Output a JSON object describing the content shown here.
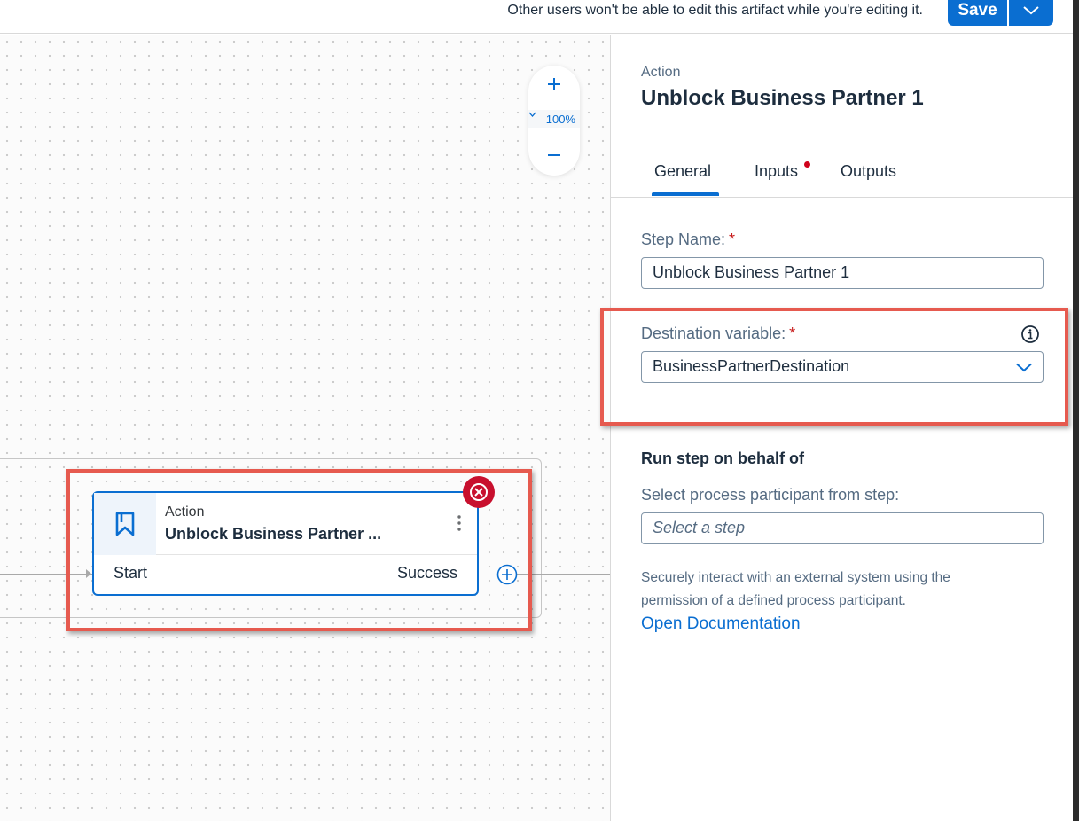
{
  "topbar": {
    "lock_message": "Other users won't be able to edit this artifact while you're editing it.",
    "save_label": "Save"
  },
  "canvas": {
    "zoom_level": "100%",
    "node": {
      "type": "Action",
      "title": "Unblock Business Partner ...",
      "start_label": "Start",
      "success_label": "Success",
      "icon": "bookmark-icon"
    }
  },
  "panel": {
    "type": "Action",
    "title": "Unblock Business Partner 1",
    "tabs": [
      {
        "label": "General",
        "active": true
      },
      {
        "label": "Inputs",
        "has_error": true
      },
      {
        "label": "Outputs"
      }
    ],
    "step_name": {
      "label": "Step Name:",
      "required": "*",
      "value": "Unblock Business Partner 1"
    },
    "destination": {
      "label": "Destination variable:",
      "required": "*",
      "value": "BusinessPartnerDestination"
    },
    "behalf": {
      "title": "Run step on behalf of",
      "label": "Select process participant from step:",
      "placeholder": "Select a step",
      "description": "Securely interact with an external system using the permission of a defined process participant.",
      "link": "Open Documentation"
    }
  },
  "colors": {
    "accent": "#0a6ed1",
    "highlight": "#e65a4f",
    "error": "#bb0000"
  }
}
